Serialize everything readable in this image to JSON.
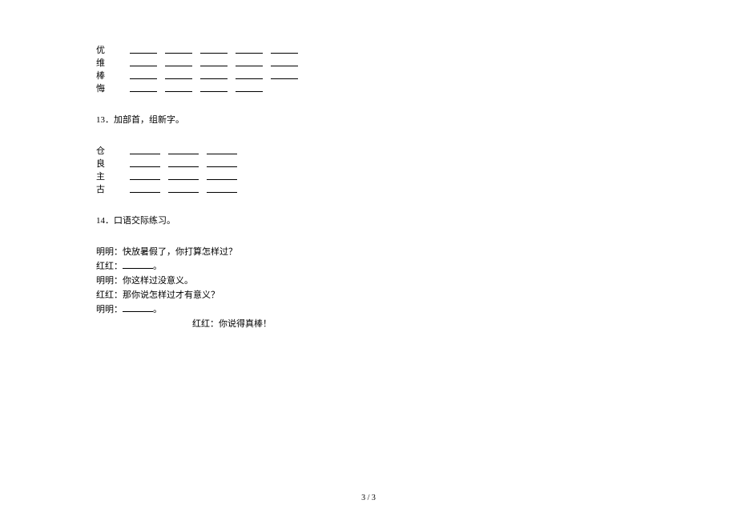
{
  "q12_chars": [
    "优",
    "维",
    "棒",
    "悔"
  ],
  "q12_blanks_per_line": [
    5,
    5,
    5,
    4
  ],
  "q13": {
    "title": "13．加部首，组新字。",
    "chars": [
      "仓",
      "良",
      "主",
      "古"
    ],
    "blanks_per_line": 3
  },
  "q14": {
    "title": "14．口语交际练习。",
    "lines": [
      {
        "speaker": "明明：",
        "text": "快放暑假了，你打算怎样过？",
        "has_blank": false
      },
      {
        "speaker": "红红：",
        "text": "",
        "has_blank": true,
        "suffix": "。"
      },
      {
        "speaker": "明明：",
        "text": "你这样过没意义。",
        "has_blank": false
      },
      {
        "speaker": "红红：",
        "text": "那你说怎样过才有意义？",
        "has_blank": false
      },
      {
        "speaker": "明明：",
        "text": "",
        "has_blank": true,
        "suffix": "。"
      }
    ],
    "final_line": {
      "speaker": "红红：",
      "text": "你说得真棒！"
    }
  },
  "footer": {
    "page_current": "3",
    "page_sep": " / ",
    "page_total": "3"
  }
}
